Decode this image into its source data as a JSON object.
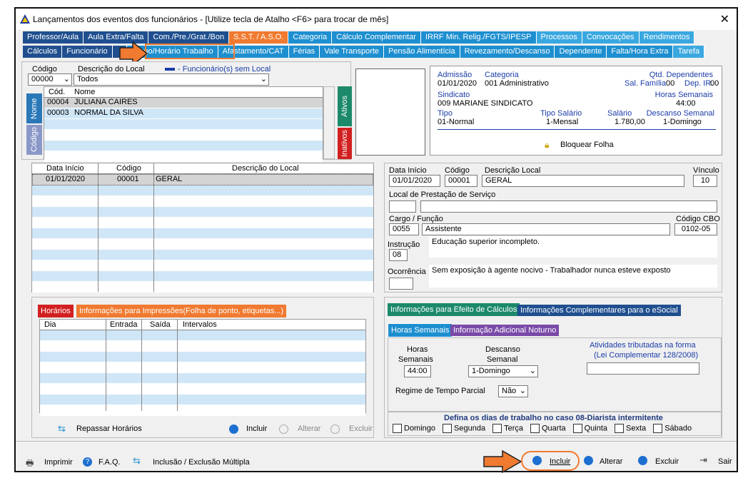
{
  "window": {
    "title": "Lançamentos dos eventos dos funcionários - [Utilize tecla de Atalho <F6> para trocar de mês]",
    "close": "✕"
  },
  "tabs_top": [
    {
      "label": "Professor/Aula",
      "color": "#1f4f8f"
    },
    {
      "label": "Aula Extra/Falta",
      "color": "#1f4f8f"
    },
    {
      "label": "Com./Pre./Grat./Bon",
      "color": "#1f4f8f"
    },
    {
      "label": "S.S.T. / A.S.O.",
      "color": "#f07a30"
    },
    {
      "label": "Categoria",
      "color": "#1d8fd0"
    },
    {
      "label": "Cálculo Complementar",
      "color": "#1d8fd0"
    },
    {
      "label": "IRRF Min. Relig./FGTS/IPESP",
      "color": "#1d8fd0"
    },
    {
      "label": "Processos",
      "color": "#3aa8e0"
    },
    {
      "label": "Convocações",
      "color": "#3aa8e0"
    },
    {
      "label": "Rendimentos",
      "color": "#3aa8e0"
    }
  ],
  "tabs_bottom": [
    {
      "label": "Cálculos",
      "color": "#1f4f8f"
    },
    {
      "label": "Funcionário",
      "color": "#1f4f8f"
    },
    {
      "label": "",
      "color": "#1f4f8f"
    },
    {
      "label": "Cargo/Horário Trabalho",
      "color": "#1d8fd0"
    },
    {
      "label": "Afastamento/CAT",
      "color": "#1d8fd0"
    },
    {
      "label": "Férias",
      "color": "#1d8fd0"
    },
    {
      "label": "Vale Transporte",
      "color": "#1d8fd0"
    },
    {
      "label": "Pensão Alimentícia",
      "color": "#1d8fd0"
    },
    {
      "label": "Revezamento/Descanso",
      "color": "#1d8fd0"
    },
    {
      "label": "Dependente",
      "color": "#1d8fd0"
    },
    {
      "label": "Falta/Hora Extra",
      "color": "#1d8fd0"
    },
    {
      "label": "Tarefa",
      "color": "#3aa8e0"
    }
  ],
  "filter": {
    "codigo_label": "Código",
    "descricao_label": "Descrição do Local",
    "legend": "- Funcionário(s) sem Local",
    "codigo_value": "00000",
    "descricao_value": "Todos"
  },
  "employees": {
    "col_cod": "Cód.",
    "col_nome": "Nome",
    "side_nome": "Nome",
    "side_codigo": "Código",
    "side_ativos": "Ativos",
    "side_inativos": "Inativos",
    "rows": [
      {
        "cod": "00004",
        "nome": "JULIANA CAIRES"
      },
      {
        "cod": "00003",
        "nome": "NORMAL DA SILVA"
      }
    ]
  },
  "info": {
    "admissao_label": "Admissão",
    "admissao": "01/01/2020",
    "categoria_label": "Categoria",
    "categoria": "001  Administrativo",
    "dependentes_label": "Qtd. Dependentes",
    "sal_familia_label": "Sal. Família",
    "sal_familia": "00",
    "dep_ir_label": "Dep. IR.",
    "dep_ir": "00",
    "sindicato_label": "Sindicato",
    "sindicato": "009  MARIANE SINDICATO",
    "horas_sem_label": "Horas Semanais",
    "horas_sem": "44:00",
    "tipo_label": "Tipo",
    "tipo": "01-Normal",
    "tipo_salario_label": "Tipo Salário",
    "tipo_salario": "1-Mensal",
    "salario_label": "Salário",
    "salario": "1.780,00",
    "descanso_label": "Descanso Semanal",
    "descanso": "1-Domingo",
    "bloquear": "Bloquear Folha"
  },
  "locations": {
    "col_data": "Data Início",
    "col_codigo": "Código",
    "col_desc": "Descrição do Local",
    "rows": [
      {
        "data": "01/01/2020",
        "codigo": "00001",
        "desc": "GERAL"
      }
    ]
  },
  "detail": {
    "data_label": "Data Início",
    "data": "01/01/2020",
    "codigo_label": "Código",
    "codigo": "00001",
    "desc_label": "Descrição Local",
    "desc": "GERAL",
    "vinculo_label": "Vínculo",
    "vinculo": "10",
    "local_prest_label": "Local de Prestação de Serviço",
    "cargo_label": "Cargo  /  Função",
    "cargo_cod": "0055",
    "cargo": "Assistente",
    "cbo_label": "Código CBO",
    "cbo": "0102-05",
    "instrucao_label": "Instrução",
    "instrucao": "08",
    "instrucao_desc": "Educação superior incompleto.",
    "ocorrencia_label": "Ocorrência",
    "ocorrencia_desc": "Sem exposição à agente nocivo - Trabalhador nunca esteve exposto"
  },
  "horarios": {
    "tab1": "Horários",
    "tab2": "Informações para Impressões(Folha de ponto, etiquetas...)",
    "col_dia": "Dia",
    "col_entrada": "Entrada",
    "col_saida": "Saída",
    "col_intervalos": "Intervalos",
    "repassar": "Repassar Horários",
    "incluir": "Incluir",
    "alterar": "Alterar",
    "excluir": "Excluir"
  },
  "calc": {
    "tab1": "Informações para Efeito de Cálculos",
    "tab2": "Informações Complementares para o eSocial",
    "sub1": "Horas Semanais",
    "sub2": "Informação Adicional Noturno",
    "horas_label1": "Horas",
    "horas_label2": "Semanais",
    "horas": "44:00",
    "descanso_label1": "Descanso",
    "descanso_label2": "Semanal",
    "descanso": "1-Domingo",
    "atividades_label1": "Atividades tributadas na forma",
    "atividades_label2": "(Lei Complementar 128/2008)",
    "regime_label": "Regime de Tempo Parcial",
    "regime": "Não",
    "dias_title": "Defina os dias de trabalho no caso 08-Diarista intermitente",
    "dias": [
      "Domingo",
      "Segunda",
      "Terça",
      "Quarta",
      "Quinta",
      "Sexta",
      "Sábado"
    ]
  },
  "bottom": {
    "imprimir": "Imprimir",
    "faq": "F.A.Q.",
    "inclusao": "Inclusão / Exclusão Múltipla",
    "incluir": "Incluir",
    "alterar": "Alterar",
    "excluir": "Excluir",
    "sair": "Sair"
  }
}
